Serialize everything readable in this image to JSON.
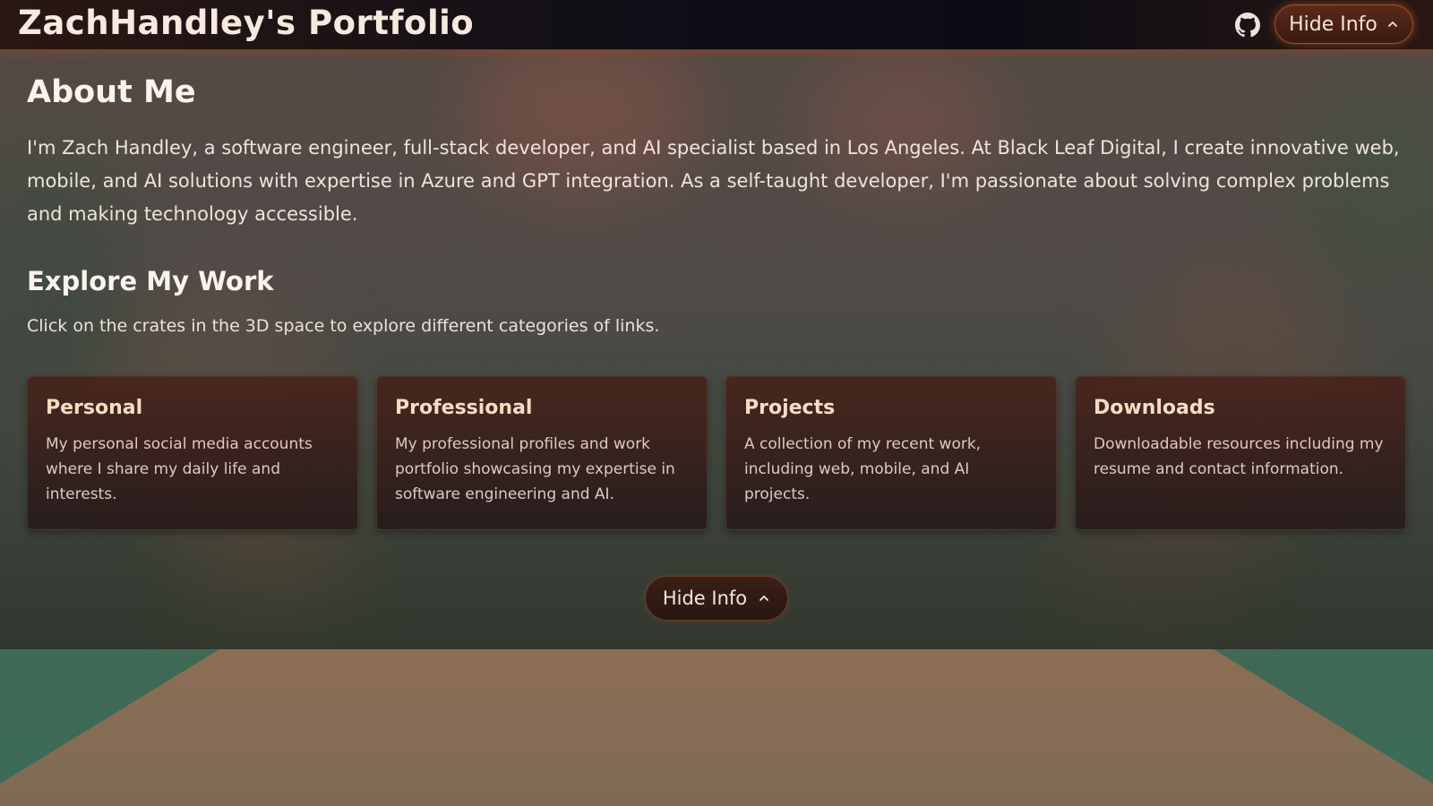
{
  "header": {
    "title": "ZachHandley's Portfolio",
    "toggle_label": "Hide Info",
    "github_icon": "github-icon"
  },
  "about": {
    "heading": "About Me",
    "text": "I'm Zach Handley, a software engineer, full-stack developer, and AI specialist based in Los Angeles. At Black Leaf Digital, I create innovative web, mobile, and AI solutions with expertise in Azure and GPT integration. As a self-taught developer, I'm passionate about solving complex problems and making technology accessible."
  },
  "explore": {
    "heading": "Explore My Work",
    "text": "Click on the crates in the 3D space to explore different categories of links."
  },
  "cards": [
    {
      "title": "Personal",
      "description": "My personal social media accounts where I share my daily life and interests."
    },
    {
      "title": "Professional",
      "description": "My professional profiles and work portfolio showcasing my expertise in software engineering and AI."
    },
    {
      "title": "Projects",
      "description": "A collection of my recent work, including web, mobile, and AI projects."
    },
    {
      "title": "Downloads",
      "description": "Downloadable resources including my resume and contact information."
    }
  ],
  "bottom_toggle": {
    "label": "Hide Info"
  },
  "colors": {
    "accent": "#a5532b",
    "card_title": "#f6dcc4",
    "topbar": "#0f0f17"
  }
}
